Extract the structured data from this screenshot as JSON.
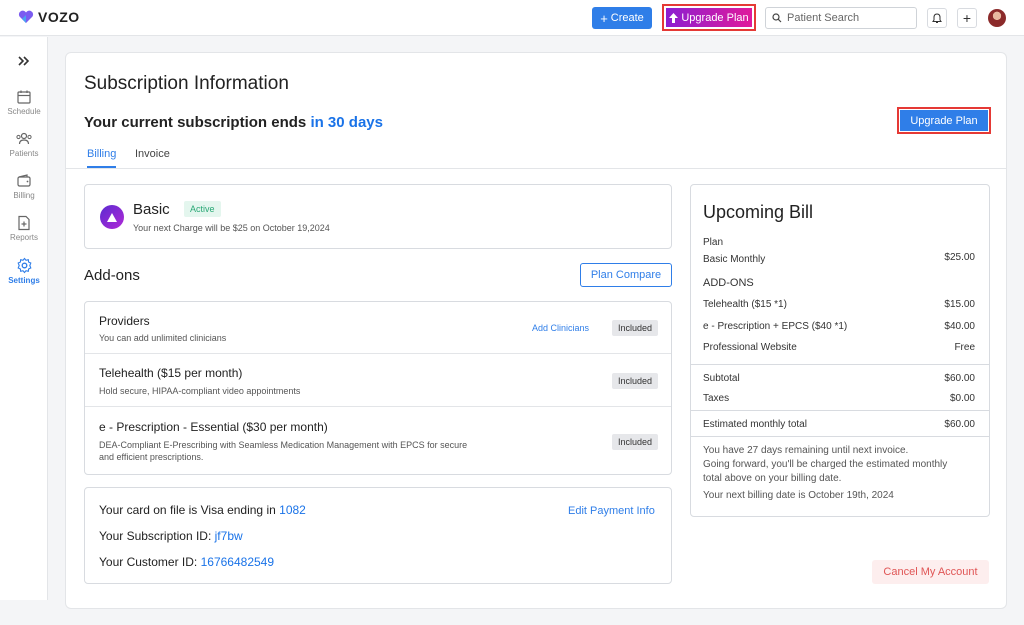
{
  "app": {
    "name": "VOZO"
  },
  "topbar": {
    "create_label": "Create",
    "upgrade_label": "Upgrade Plan",
    "search_placeholder": "Patient Search"
  },
  "sidebar": {
    "items": [
      {
        "label": "Schedule",
        "icon": "calendar-icon"
      },
      {
        "label": "Patients",
        "icon": "people-icon"
      },
      {
        "label": "Billing",
        "icon": "wallet-icon"
      },
      {
        "label": "Reports",
        "icon": "report-icon"
      },
      {
        "label": "Settings",
        "icon": "gear-icon",
        "active": true
      }
    ]
  },
  "page": {
    "title": "Subscription Information",
    "subscription_prefix": "Your current subscription ends",
    "subscription_days": "in 30 days",
    "upgrade_label": "Upgrade Plan",
    "tabs": [
      {
        "label": "Billing",
        "active": true
      },
      {
        "label": "Invoice",
        "active": false
      }
    ]
  },
  "plan": {
    "name": "Basic",
    "status": "Active",
    "next_charge": "Your next Charge will be $25 on October 19,2024"
  },
  "addons": {
    "title": "Add-ons",
    "compare_label": "Plan Compare",
    "add_clinicians_label": "Add Clinicians",
    "items": [
      {
        "name": "Providers",
        "desc": "You can add unlimited clinicians",
        "status": "Included"
      },
      {
        "name": "Telehealth ($15 per month)",
        "desc": "Hold secure, HIPAA-compliant video appointments",
        "status": "Included"
      },
      {
        "name": "e - Prescription - Essential ($30 per month)",
        "desc_line1": " DEA-Compliant E-Prescribing with Seamless Medication Management with EPCS for secure",
        "desc_line2": "and efficient prescriptions.",
        "status": "Included"
      }
    ]
  },
  "payment": {
    "card_prefix": "Your card on file is Visa ending in",
    "card_last4": "1082",
    "subscription_id_label": "Your Subscription ID:",
    "subscription_id": "jf7bw",
    "customer_id_label": "Your Customer ID:",
    "customer_id": "16766482549",
    "edit_label": "Edit Payment Info"
  },
  "bill": {
    "title": "Upcoming Bill",
    "plan_label": "Plan",
    "plan_name": "Basic Monthly",
    "plan_price": "$25.00",
    "addons_heading": "ADD-ONS",
    "lines": [
      {
        "label": "Telehealth  ($15 *1)",
        "value": "$15.00"
      },
      {
        "label": "e - Prescription + EPCS ($40 *1)",
        "value": "$40.00"
      },
      {
        "label": "Professional Website",
        "value": "Free"
      }
    ],
    "subtotal_label": "Subtotal",
    "subtotal": "$60.00",
    "taxes_label": "Taxes",
    "taxes": "$0.00",
    "estimated_label": "Estimated monthly total",
    "estimated": "$60.00",
    "note_line1": "You have 27 days remaining until next invoice.",
    "note_line2": "Going forward, you'll be charged the estimated monthly",
    "note_line3": "total above on your billing date.",
    "note_line4": "Your next billing date is October 19th, 2024"
  },
  "cancel_label": "Cancel My Account",
  "colors": {
    "accent": "#2f7ee8",
    "highlight": "#e53935",
    "upgrade_gradient_start": "#8b1fd1",
    "upgrade_gradient_end": "#e01a9b"
  }
}
